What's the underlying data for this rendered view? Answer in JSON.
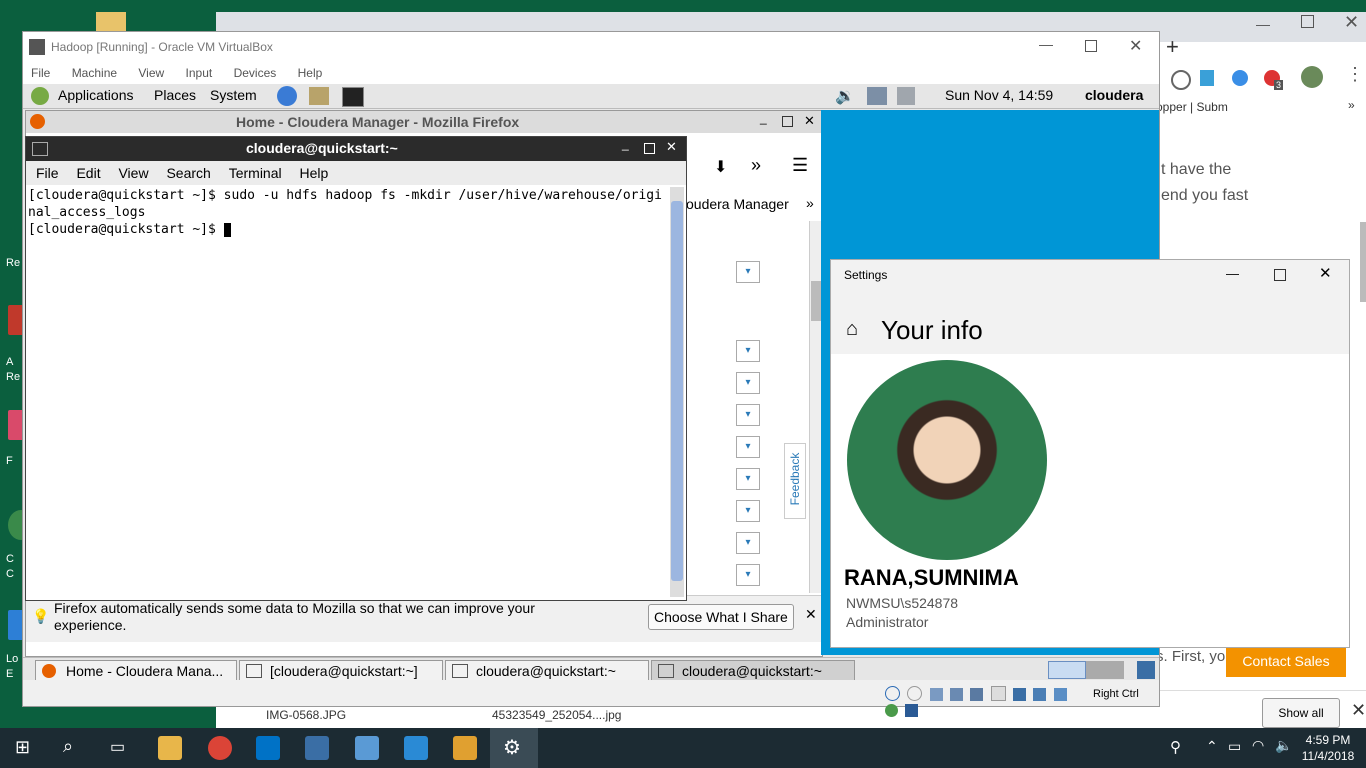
{
  "colors": {
    "accent_orange": "#f39200",
    "firefox_blue": "#0096d6",
    "taskbar": "#1c2b33"
  },
  "desktop": {
    "labels": [
      "Re",
      "A",
      "Re",
      "F",
      "C",
      "C",
      "Lo",
      "E"
    ]
  },
  "chrome": {
    "bookmark": "opper | Subm",
    "page_text_1": "t have the",
    "page_text_2": "end you fast",
    "first_text": "s. First, yo",
    "contact_sales": "Contact Sales",
    "show_all": "Show all",
    "downloads": [
      "IMG-0568.JPG",
      "45323549_252054....jpg"
    ],
    "badge": "3"
  },
  "vbox": {
    "title": "Hadoop [Running] - Oracle VM VirtualBox",
    "menu": [
      "File",
      "Machine",
      "View",
      "Input",
      "Devices",
      "Help"
    ],
    "host_key": "Right Ctrl"
  },
  "guest": {
    "menu": [
      "Applications",
      "Places",
      "System"
    ],
    "clock": "Sun Nov  4, 14:59",
    "user": "cloudera",
    "tasks": [
      "Home - Cloudera Mana...",
      "[cloudera@quickstart:~]",
      "cloudera@quickstart:~",
      "cloudera@quickstart:~"
    ]
  },
  "firefox": {
    "title": "Home - Cloudera Manager - Mozilla Firefox",
    "tab": "oudera Manager",
    "feedback": "Feedback",
    "notice": "Firefox automatically sends some data to Mozilla so that we can improve your experience.",
    "choose_btn": "Choose What I Share"
  },
  "terminal": {
    "title": "cloudera@quickstart:~",
    "menu": [
      "File",
      "Edit",
      "View",
      "Search",
      "Terminal",
      "Help"
    ],
    "line1": "[cloudera@quickstart ~]$ sudo -u hdfs hadoop fs -mkdir /user/hive/warehouse/original_access_logs",
    "line2": "[cloudera@quickstart ~]$ "
  },
  "settings": {
    "title": "Settings",
    "heading": "Your info",
    "name": "RANA,SUMNIMA",
    "account": "NWMSU\\s524878",
    "role": "Administrator"
  },
  "taskbar": {
    "time": "4:59 PM",
    "date": "11/4/2018"
  }
}
